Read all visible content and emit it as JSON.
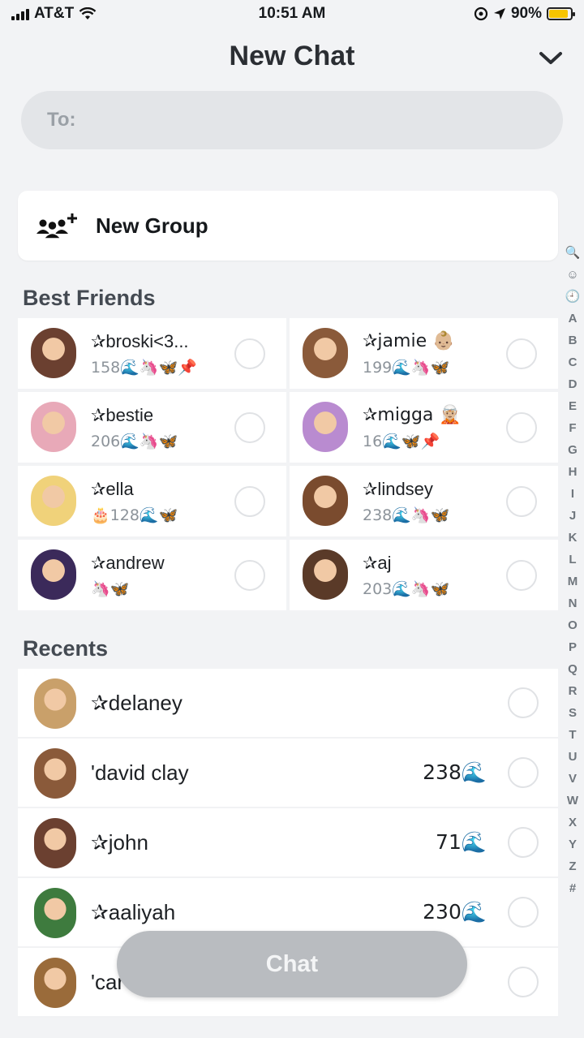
{
  "status_bar": {
    "carrier": "AT&T",
    "time": "10:51 AM",
    "battery": "90%",
    "battery_level": 0.9
  },
  "header": {
    "title": "New Chat"
  },
  "to_field": {
    "label": "To:"
  },
  "new_group": {
    "label": "New Group"
  },
  "best_friends": {
    "title": "Best Friends",
    "items": [
      {
        "name": "✰broski<3...",
        "sub": "158🌊🦄🦋📌",
        "avatar_color": "#6b4030"
      },
      {
        "name": "✰jamie 👶🏼",
        "sub": "199🌊🦄🦋",
        "avatar_color": "#8a5a3a"
      },
      {
        "name": "✰bestie",
        "sub": "206🌊🦄🦋",
        "avatar_color": "#e8a9b8"
      },
      {
        "name": "✰migga 🧝🏼",
        "sub": "16🌊🦋📌",
        "avatar_color": "#b98bd0"
      },
      {
        "name": "✰ella",
        "sub": "🎂128🌊🦋",
        "avatar_color": "#f0d27a"
      },
      {
        "name": "✰lindsey",
        "sub": "238🌊🦄🦋",
        "avatar_color": "#7a4b2e"
      },
      {
        "name": "✰andrew",
        "sub": "🦄🦋",
        "avatar_color": "#3b2a5a"
      },
      {
        "name": "✰aj",
        "sub": "203🌊🦄🦋",
        "avatar_color": "#5a3a28"
      }
    ]
  },
  "recents": {
    "title": "Recents",
    "items": [
      {
        "name": "✰delaney",
        "streak": "",
        "avatar_color": "#c9a06a"
      },
      {
        "name": "'david clay",
        "streak": "238🌊",
        "avatar_color": "#8a5a3a"
      },
      {
        "name": "✰john",
        "streak": "71🌊",
        "avatar_color": "#6b4030"
      },
      {
        "name": "✰aaliyah",
        "streak": "230🌊",
        "avatar_color": "#3e7b3e"
      },
      {
        "name": "'car",
        "streak": "",
        "avatar_color": "#9a6b3a"
      }
    ]
  },
  "alpha_index": [
    "🔍",
    "☺",
    "🕘",
    "A",
    "B",
    "C",
    "D",
    "E",
    "F",
    "G",
    "H",
    "I",
    "J",
    "K",
    "L",
    "M",
    "N",
    "O",
    "P",
    "Q",
    "R",
    "S",
    "T",
    "U",
    "V",
    "W",
    "X",
    "Y",
    "Z",
    "#"
  ],
  "chat_button": {
    "label": "Chat"
  },
  "icons": {
    "wifi": "wifi-icon",
    "location": "location-arrow-icon",
    "collapse": "chevron-down-icon",
    "new_group": "add-group-icon"
  }
}
